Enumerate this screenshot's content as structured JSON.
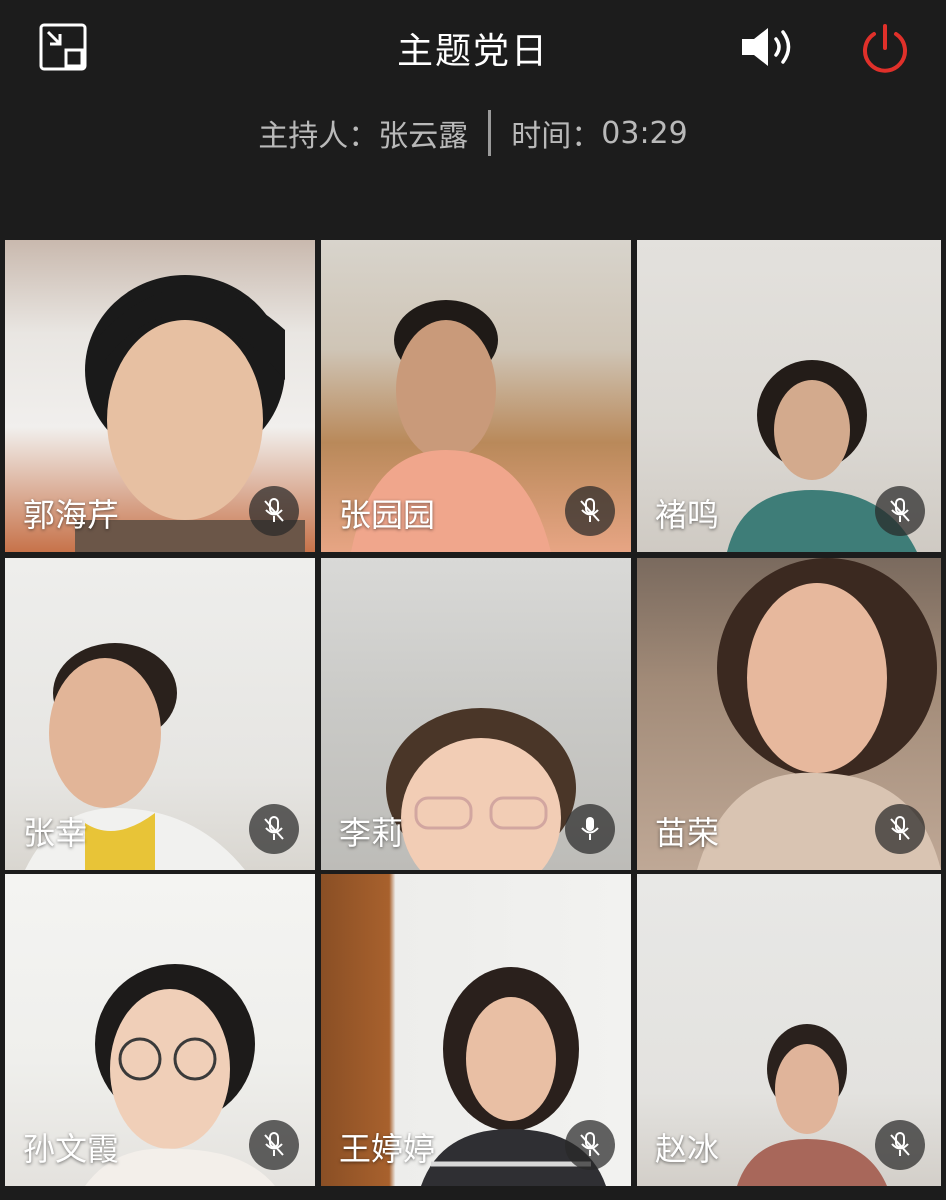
{
  "header": {
    "title": "主题党日",
    "host_label": "主持人：",
    "host_name": "张云露",
    "time_label": "时间：",
    "time_value": "03:29",
    "exit_fullscreen_icon": "exit-fullscreen-icon",
    "speaker_icon": "speaker-icon",
    "power_icon": "power-icon",
    "power_color": "#e0302a"
  },
  "participants": [
    {
      "name": "郭海芹",
      "mic": "muted"
    },
    {
      "name": "张园园",
      "mic": "muted"
    },
    {
      "name": "褚鸣",
      "mic": "muted"
    },
    {
      "name": "张幸",
      "mic": "muted"
    },
    {
      "name": "李莉",
      "mic": "on"
    },
    {
      "name": "苗荣",
      "mic": "muted"
    },
    {
      "name": "孙文霞",
      "mic": "muted"
    },
    {
      "name": "王婷婷",
      "mic": "muted"
    },
    {
      "name": "赵冰",
      "mic": "muted"
    }
  ]
}
